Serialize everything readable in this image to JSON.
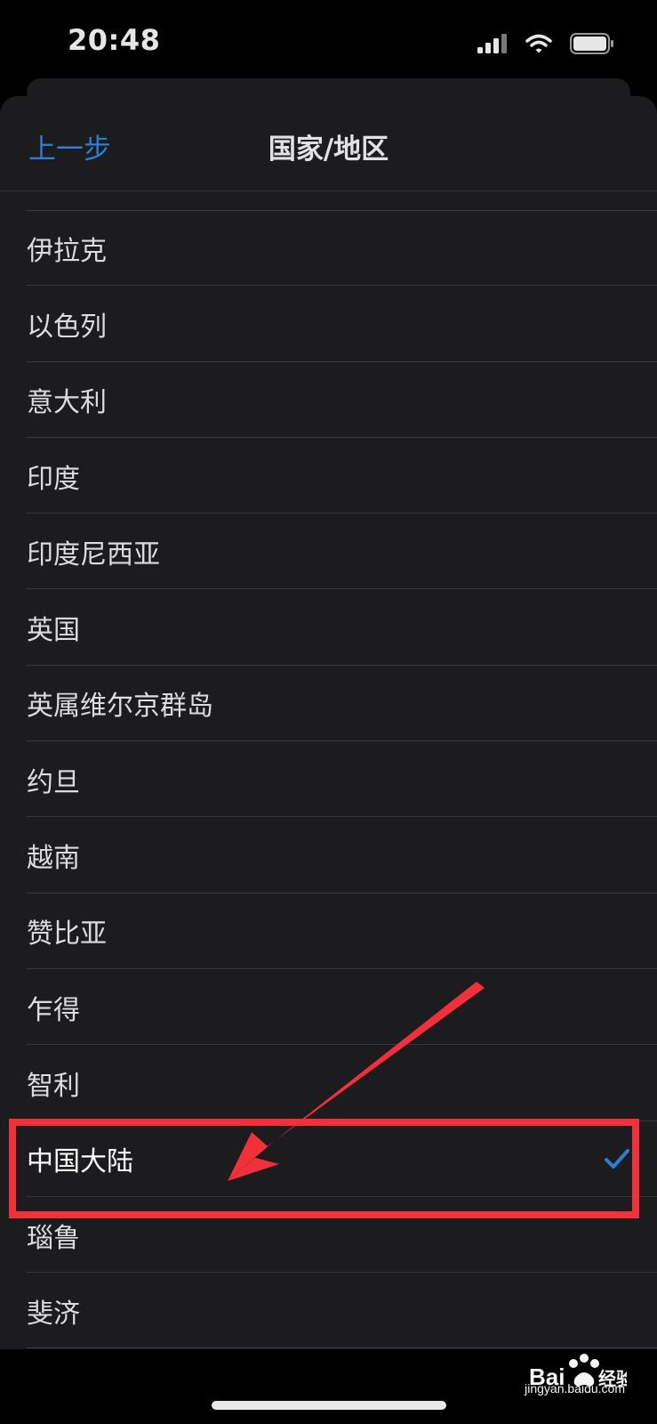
{
  "status_bar": {
    "time": "20:48",
    "icons": [
      "cellular-signal-icon",
      "wifi-icon",
      "battery-icon"
    ]
  },
  "nav": {
    "back_label": "上一步",
    "title": "国家/地区"
  },
  "countries": [
    {
      "label": "伊拉克"
    },
    {
      "label": "以色列"
    },
    {
      "label": "意大利"
    },
    {
      "label": "印度"
    },
    {
      "label": "印度尼西亚"
    },
    {
      "label": "英国"
    },
    {
      "label": "英属维尔京群岛"
    },
    {
      "label": "约旦"
    },
    {
      "label": "越南"
    },
    {
      "label": "赞比亚"
    },
    {
      "label": "乍得"
    },
    {
      "label": "智利"
    },
    {
      "label": "中国大陆",
      "selected": true
    },
    {
      "label": "瑙鲁"
    },
    {
      "label": "斐济"
    }
  ],
  "colors": {
    "accent": "#2f7cd4",
    "annotation": "#f2303a",
    "sheet_background": "#1c1c1e"
  },
  "watermark": {
    "brand": "Bai du 经验",
    "url": "jingyan.baidu.com"
  }
}
